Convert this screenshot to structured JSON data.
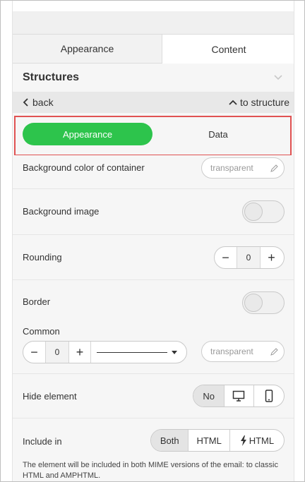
{
  "tabs": [
    {
      "label": "Appearance"
    },
    {
      "label": "Content"
    }
  ],
  "structures": {
    "title": "Structures"
  },
  "nav": {
    "back": "back",
    "to_structure": "to structure"
  },
  "mode_switch": {
    "appearance": "Appearance",
    "data": "Data",
    "active": "Appearance"
  },
  "background_color": {
    "label": "Background color of container",
    "value": "transparent"
  },
  "background_image": {
    "label": "Background image",
    "enabled": false
  },
  "rounding": {
    "label": "Rounding",
    "value": "0",
    "minus": "−",
    "plus": "+"
  },
  "border": {
    "label": "Border",
    "enabled": false,
    "common_label": "Common",
    "width_value": "0",
    "minus": "−",
    "plus": "+",
    "color_value": "transparent"
  },
  "hide_element": {
    "label": "Hide element",
    "options": [
      "No",
      "desktop-icon",
      "mobile-icon"
    ],
    "selected": "No"
  },
  "include_in": {
    "label": "Include in",
    "options": [
      "Both",
      "HTML",
      "HTML"
    ],
    "selected": "Both",
    "note": "The element will be included in both MIME versions of the email: to classic HTML and AMPHTML."
  },
  "colors": {
    "accent": "#2dc44c",
    "highlight_border": "#e05252",
    "panel_bg": "#f6f6f6"
  }
}
